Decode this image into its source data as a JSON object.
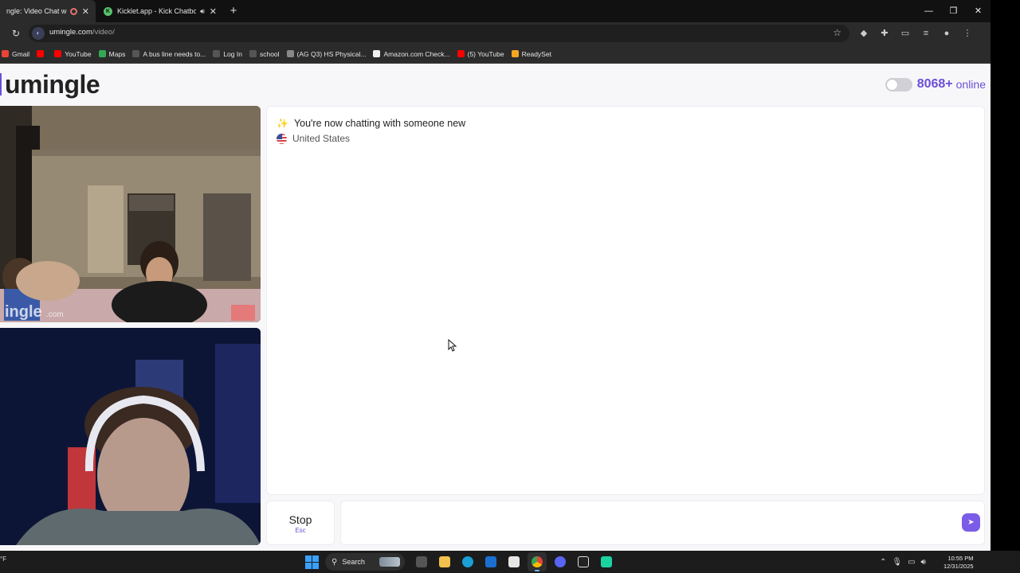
{
  "browser": {
    "tabs": [
      {
        "title": "ngle: Video Chat with S",
        "active": true
      },
      {
        "title": "Kicklet.app - Kick Chatbot a",
        "active": false
      }
    ],
    "new_tab_icon": "plus-icon",
    "url_domain": "umingle.com",
    "url_path": "/video/",
    "bookmarks": [
      {
        "label": "Gmail",
        "icon": "gmail-icon",
        "color": "#ea4335"
      },
      {
        "label": "",
        "icon": "youtube-icon",
        "color": "#ff0000"
      },
      {
        "label": "YouTube",
        "icon": "youtube-icon",
        "color": "#ff0000"
      },
      {
        "label": "Maps",
        "icon": "maps-icon",
        "color": "#34a853"
      },
      {
        "label": "A bus line needs to...",
        "icon": "bookmark-icon",
        "color": "#555555"
      },
      {
        "label": "Log In",
        "icon": "bookmark-icon",
        "color": "#555555"
      },
      {
        "label": "school",
        "icon": "bookmark-icon",
        "color": "#555555"
      },
      {
        "label": "(AG Q3) HS Physical...",
        "icon": "globe-icon",
        "color": "#888888"
      },
      {
        "label": "Amazon.com Check...",
        "icon": "amazon-icon",
        "color": "#f0f0f0"
      },
      {
        "label": "(5) YouTube",
        "icon": "youtube-icon",
        "color": "#ff0000"
      },
      {
        "label": "ReadySet",
        "icon": "readyset-icon",
        "color": "#f5a623"
      }
    ]
  },
  "site": {
    "logo": "umingle",
    "accent_color": "#6b4fd8",
    "online_count": "8068+",
    "online_label": "online"
  },
  "chat": {
    "status": "You're now chatting with someone new",
    "location": "United States",
    "stop_label": "Stop",
    "stop_hint": "Esc",
    "input_value": "",
    "send_icon": "send-icon"
  },
  "taskbar": {
    "weather": "°F",
    "search_label": "Search",
    "time": "10:55 PM",
    "date": "12/31/2025"
  }
}
